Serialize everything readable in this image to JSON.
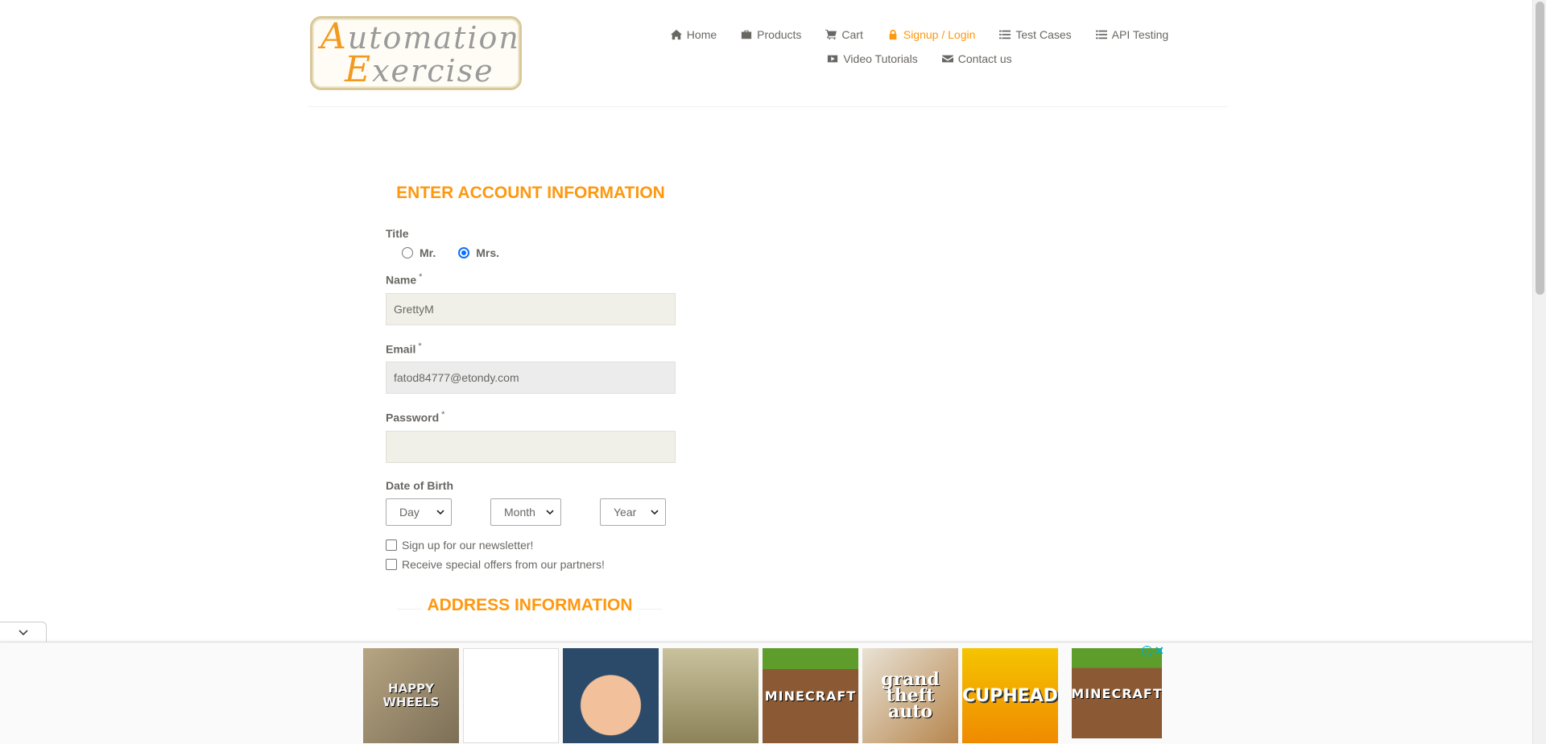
{
  "header": {
    "logo_text_line1": "Automation",
    "logo_text_line2": "Exercise",
    "nav": [
      {
        "label": "Home",
        "icon": "home-icon"
      },
      {
        "label": "Products",
        "icon": "briefcase-icon"
      },
      {
        "label": "Cart",
        "icon": "cart-icon"
      },
      {
        "label": "Signup / Login",
        "icon": "lock-icon",
        "active": true
      },
      {
        "label": "Test Cases",
        "icon": "list-icon"
      },
      {
        "label": "API Testing",
        "icon": "list-icon"
      },
      {
        "label": "Video Tutorials",
        "icon": "youtube-icon"
      },
      {
        "label": "Contact us",
        "icon": "envelope-icon"
      }
    ]
  },
  "form": {
    "section_title": "ENTER ACCOUNT INFORMATION",
    "title_label": "Title",
    "title_options": [
      {
        "label": "Mr.",
        "checked": false
      },
      {
        "label": "Mrs.",
        "checked": true
      }
    ],
    "name_label": "Name",
    "name_value": "GrettyM",
    "email_label": "Email",
    "email_value": "fatod84777@etondy.com",
    "password_label": "Password",
    "password_value": "",
    "required_mark": "*",
    "dob_label": "Date of Birth",
    "dob_day": "Day",
    "dob_month": "Month",
    "dob_year": "Year",
    "newsletter_label": "Sign up for our newsletter!",
    "newsletter_checked": false,
    "offers_label": "Receive special offers from our partners!",
    "offers_checked": false,
    "address_title": "ADDRESS INFORMATION"
  },
  "ads": {
    "tiles": [
      "HAPPY WHEELS",
      "",
      "",
      "",
      "MINECRAFT",
      "grand theft auto",
      "CUPHEAD",
      "MINECRAFT"
    ],
    "info_icon": "i",
    "close_icon": "✕"
  },
  "colors": {
    "accent": "#fe980f",
    "text": "#696763",
    "field_bg": "#f0f0e9"
  }
}
